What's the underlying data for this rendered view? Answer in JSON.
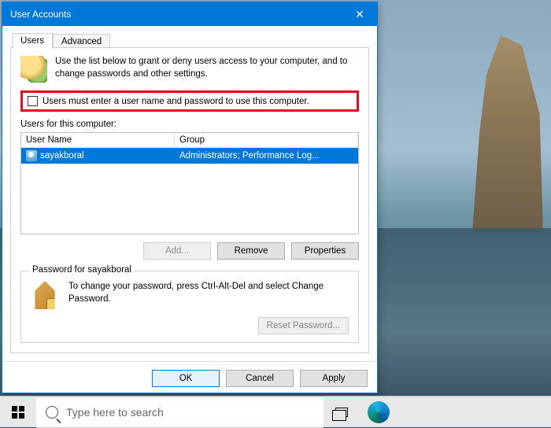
{
  "window": {
    "title": "User Accounts",
    "close_glyph": "✕"
  },
  "tabs": {
    "users": "Users",
    "advanced": "Advanced"
  },
  "intro": "Use the list below to grant or deny users access to your computer, and to change passwords and other settings.",
  "checkbox_label": "Users must enter a user name and password to use this computer.",
  "users_list": {
    "label": "Users for this computer:",
    "columns": {
      "name": "User Name",
      "group": "Group"
    },
    "rows": [
      {
        "name": "sayakboral",
        "group": "Administrators; Performance Log..."
      }
    ]
  },
  "buttons_row": {
    "add": "Add...",
    "remove": "Remove",
    "properties": "Properties"
  },
  "password_group": {
    "legend": "Password for sayakboral",
    "text": "To change your password, press Ctrl-Alt-Del and select Change Password.",
    "reset": "Reset Password..."
  },
  "dialog_buttons": {
    "ok": "OK",
    "cancel": "Cancel",
    "apply": "Apply"
  },
  "taskbar": {
    "search_placeholder": "Type here to search"
  }
}
